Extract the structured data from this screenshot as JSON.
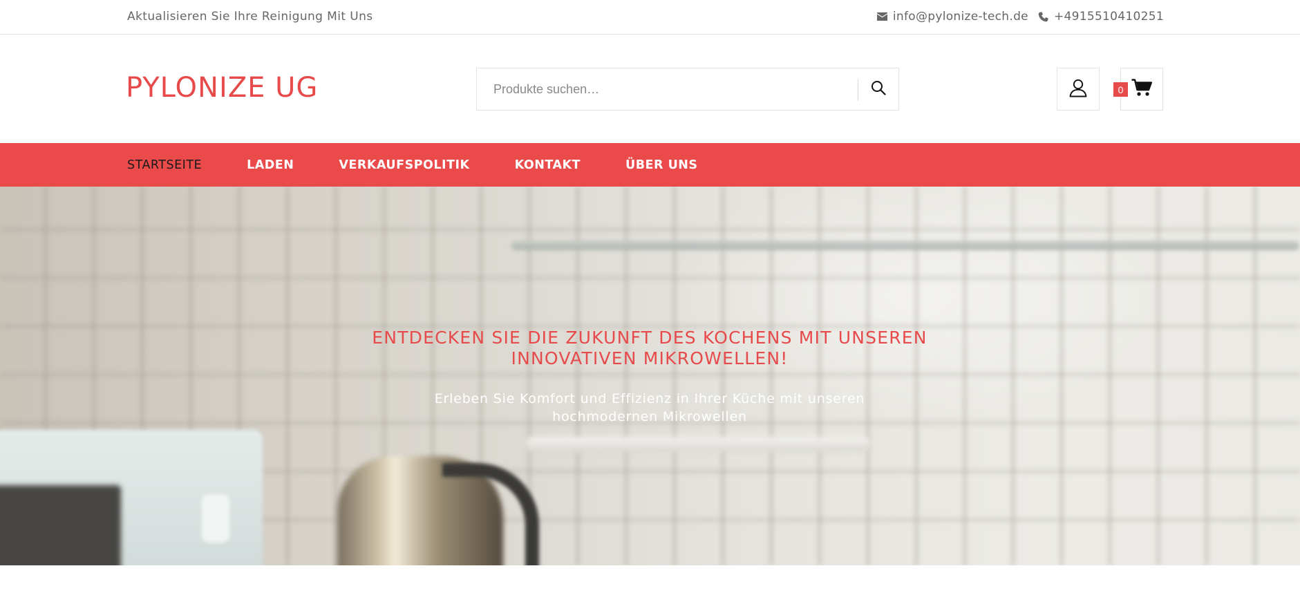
{
  "topbar": {
    "tagline": "Aktualisieren Sie Ihre Reinigung Mit Uns",
    "email": "info@pylonize-tech.de",
    "phone": "+4915510410251",
    "email_icon": "envelope-icon",
    "phone_icon": "phone-icon"
  },
  "header": {
    "logo": "PYLONIZE UG",
    "search": {
      "placeholder": "Produkte suchen…",
      "value": "",
      "icon": "search-icon"
    },
    "account_icon": "user-icon",
    "cart": {
      "count": "0",
      "icon": "cart-icon"
    }
  },
  "nav": {
    "items": [
      {
        "label": "STARTSEITE",
        "active": true
      },
      {
        "label": "LADEN",
        "active": false
      },
      {
        "label": "VERKAUFSPOLITIK",
        "active": false
      },
      {
        "label": "KONTAKT",
        "active": false
      },
      {
        "label": "ÜBER UNS",
        "active": false
      }
    ]
  },
  "hero": {
    "title_line1": "ENTDECKEN SIE DIE ZUKUNFT DES KOCHENS MIT UNSEREN",
    "title_line2": "INNOVATIVEN MIKROWELLEN!",
    "subtitle_line1": "Erleben Sie Komfort und Effizienz in Ihrer Küche mit unseren",
    "subtitle_line2": "hochmodernen Mikrowellen"
  },
  "colors": {
    "accent": "#eb4a4a",
    "logo": "#e74a4a",
    "nav_active_text": "#1a1a1a"
  }
}
